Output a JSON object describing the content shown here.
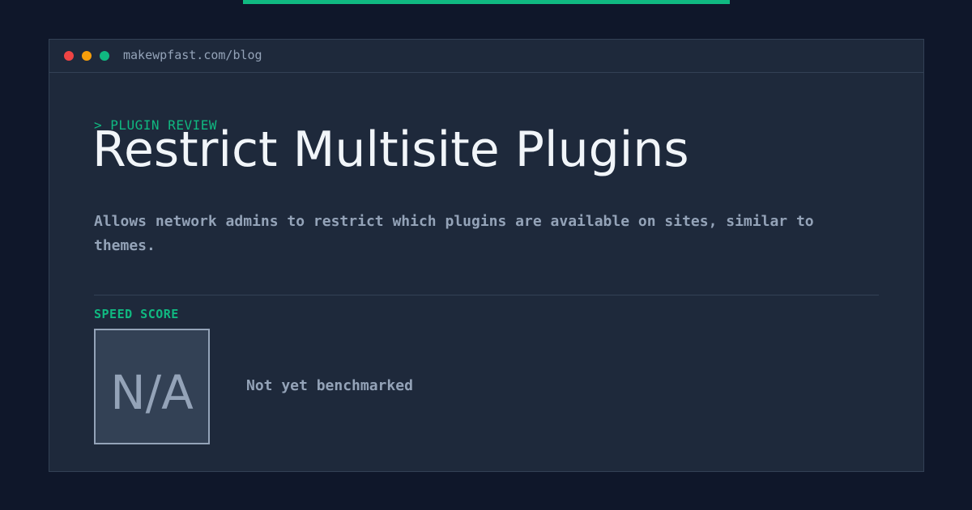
{
  "browser": {
    "url": "makewpfast.com/blog"
  },
  "article": {
    "category": "> PLUGIN REVIEW",
    "title": "Restrict Multisite Plugins",
    "description": "Allows network admins to restrict which plugins are available on sites, similar to themes."
  },
  "score": {
    "label": "SPEED SCORE",
    "value": "N/A",
    "status": "Not yet benchmarked"
  },
  "colors": {
    "background": "#0f172a",
    "panel": "#1e293b",
    "accent": "#10b981",
    "muted_text": "#94a3b8",
    "title_text": "#f1f5f9",
    "dot_red": "#ef4444",
    "dot_yellow": "#f59e0b",
    "dot_green": "#10b981"
  }
}
